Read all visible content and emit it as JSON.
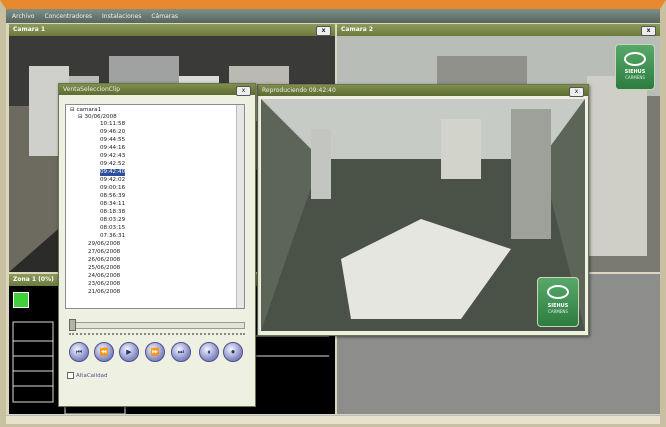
{
  "menu": [
    "Archivo",
    "Concentradores",
    "Instalaciones",
    "Cámaras"
  ],
  "panels": {
    "camera1_title": "Camara 1",
    "camera2_title": "Camara 2",
    "zone_title": "Zona 1 (0%)"
  },
  "selection_dialog": {
    "title": "VentaSeleccionClip",
    "close": "x",
    "tree": {
      "root": "camara1",
      "expanded_date": "30/06/2008",
      "times": [
        "10:11:58",
        "09:46:20",
        "09:44:55",
        "09:44:16",
        "09:42:43",
        "09:42:52",
        "09:42:40",
        "09:42:02",
        "09:00:16",
        "08:56:39",
        "08:34:11",
        "08:18:38",
        "08:03:29",
        "08:03:15",
        "07:36:31"
      ],
      "selected_time": "09:42:40",
      "other_dates": [
        "29/06/2008",
        "27/06/2008",
        "26/06/2008",
        "25/06/2008",
        "24/06/2008",
        "23/06/2008",
        "21/06/2008"
      ]
    },
    "controls": [
      "first",
      "rewind",
      "play",
      "forward",
      "last",
      "pause",
      "record"
    ],
    "checkbox_label": "AltaCalidad"
  },
  "playback": {
    "title": "Reproduciendo 09:42:40",
    "close": "x",
    "brand_line1": "SIEHUS",
    "brand_line2": "CARMENS"
  },
  "camera2_brand": {
    "line1": "SIEHUS",
    "line2": "CARMENS"
  },
  "colors": {
    "accent": "#e7892c",
    "title_bar": "#7f8f4a",
    "selected": "#2e4f9c"
  }
}
